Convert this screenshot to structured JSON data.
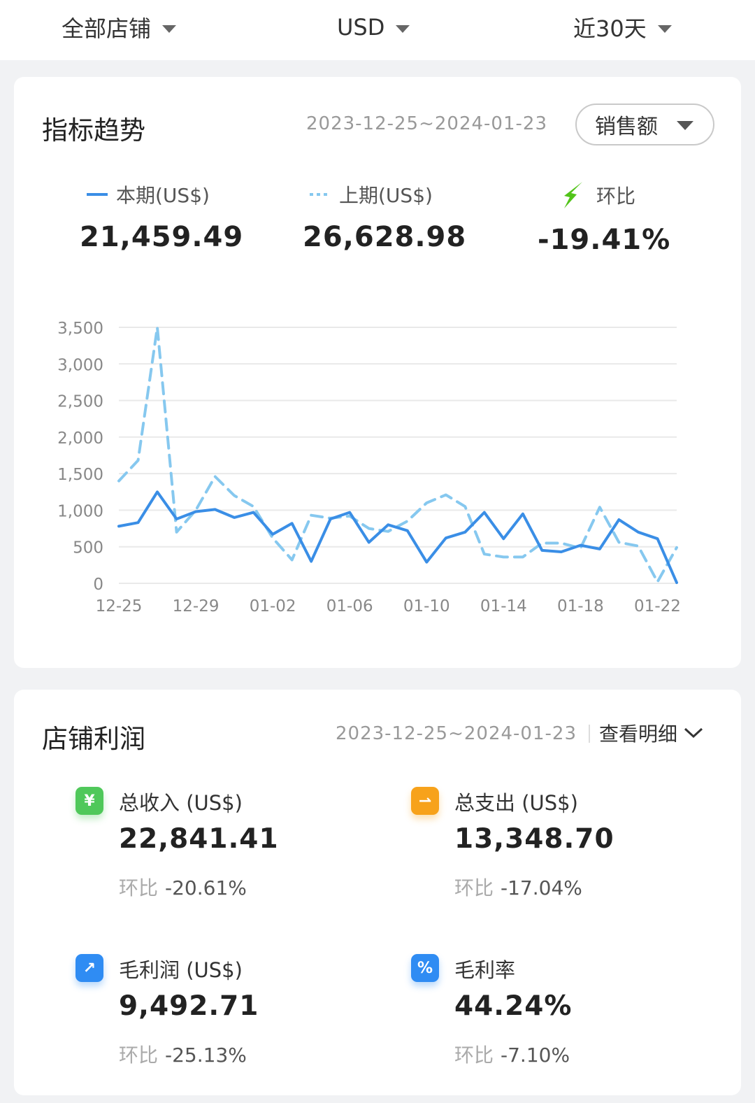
{
  "filters": {
    "store": "全部店铺",
    "currency": "USD",
    "period": "近30天"
  },
  "trend": {
    "title": "指标趋势",
    "date_range": "2023-12-25~2024-01-23",
    "metric_select": "销售额",
    "current_label": "本期(US$)",
    "current_value": "21,459.49",
    "previous_label": "上期(US$)",
    "previous_value": "26,628.98",
    "compare_label": "环比",
    "compare_value": "-19.41%",
    "colors": {
      "current": "#3a8ee6",
      "previous": "#86c8ef",
      "down_arrow": "#52c41a"
    }
  },
  "chart_data": {
    "type": "line",
    "x": [
      "12-25",
      "12-26",
      "12-27",
      "12-28",
      "12-29",
      "12-30",
      "12-31",
      "01-01",
      "01-02",
      "01-03",
      "01-04",
      "01-05",
      "01-06",
      "01-07",
      "01-08",
      "01-09",
      "01-10",
      "01-11",
      "01-12",
      "01-13",
      "01-14",
      "01-15",
      "01-16",
      "01-17",
      "01-18",
      "01-19",
      "01-20",
      "01-21",
      "01-22",
      "01-23"
    ],
    "x_tick_labels": [
      "12-25",
      "12-29",
      "01-02",
      "01-06",
      "01-10",
      "01-14",
      "01-18",
      "01-22"
    ],
    "y_ticks": [
      "0",
      "500",
      "1,000",
      "1,500",
      "2,000",
      "2,500",
      "3,000",
      "3,500"
    ],
    "ylim": [
      0,
      3500
    ],
    "grid": true,
    "series": [
      {
        "name": "本期(US$)",
        "style": "solid",
        "values": [
          780,
          830,
          1250,
          880,
          980,
          1010,
          900,
          970,
          670,
          820,
          300,
          880,
          970,
          560,
          800,
          720,
          290,
          620,
          700,
          970,
          610,
          950,
          450,
          430,
          520,
          470,
          870,
          700,
          610,
          10
        ]
      },
      {
        "name": "上期(US$)",
        "style": "dashed",
        "values": [
          1400,
          1680,
          3500,
          700,
          1000,
          1460,
          1200,
          1050,
          620,
          320,
          930,
          890,
          920,
          750,
          710,
          850,
          1100,
          1210,
          1050,
          400,
          360,
          360,
          550,
          550,
          480,
          1040,
          560,
          510,
          20,
          490
        ]
      }
    ]
  },
  "profit": {
    "title": "店铺利润",
    "date_range": "2023-12-25~2024-01-23",
    "detail_link": "查看明细",
    "stats": [
      {
        "icon": "yuan-icon",
        "icon_glyph": "¥",
        "icon_color": "#4fc85a",
        "label": "总收入 (US$)",
        "value": "22,841.41",
        "compare_label": "环比",
        "compare_value": "-20.61%"
      },
      {
        "icon": "expense-arrow-icon",
        "icon_glyph": "⇀",
        "icon_color": "#f7a21b",
        "label": "总支出 (US$)",
        "value": "13,348.70",
        "compare_label": "环比",
        "compare_value": "-17.04%"
      },
      {
        "icon": "trend-up-icon",
        "icon_glyph": "↗",
        "icon_color": "#2f8cf3",
        "label": "毛利润 (US$)",
        "value": "9,492.71",
        "compare_label": "环比",
        "compare_value": "-25.13%"
      },
      {
        "icon": "percent-icon",
        "icon_glyph": "%",
        "icon_color": "#2f8cf3",
        "label": "毛利率",
        "value": "44.24%",
        "compare_label": "环比",
        "compare_value": "-7.10%"
      }
    ]
  }
}
